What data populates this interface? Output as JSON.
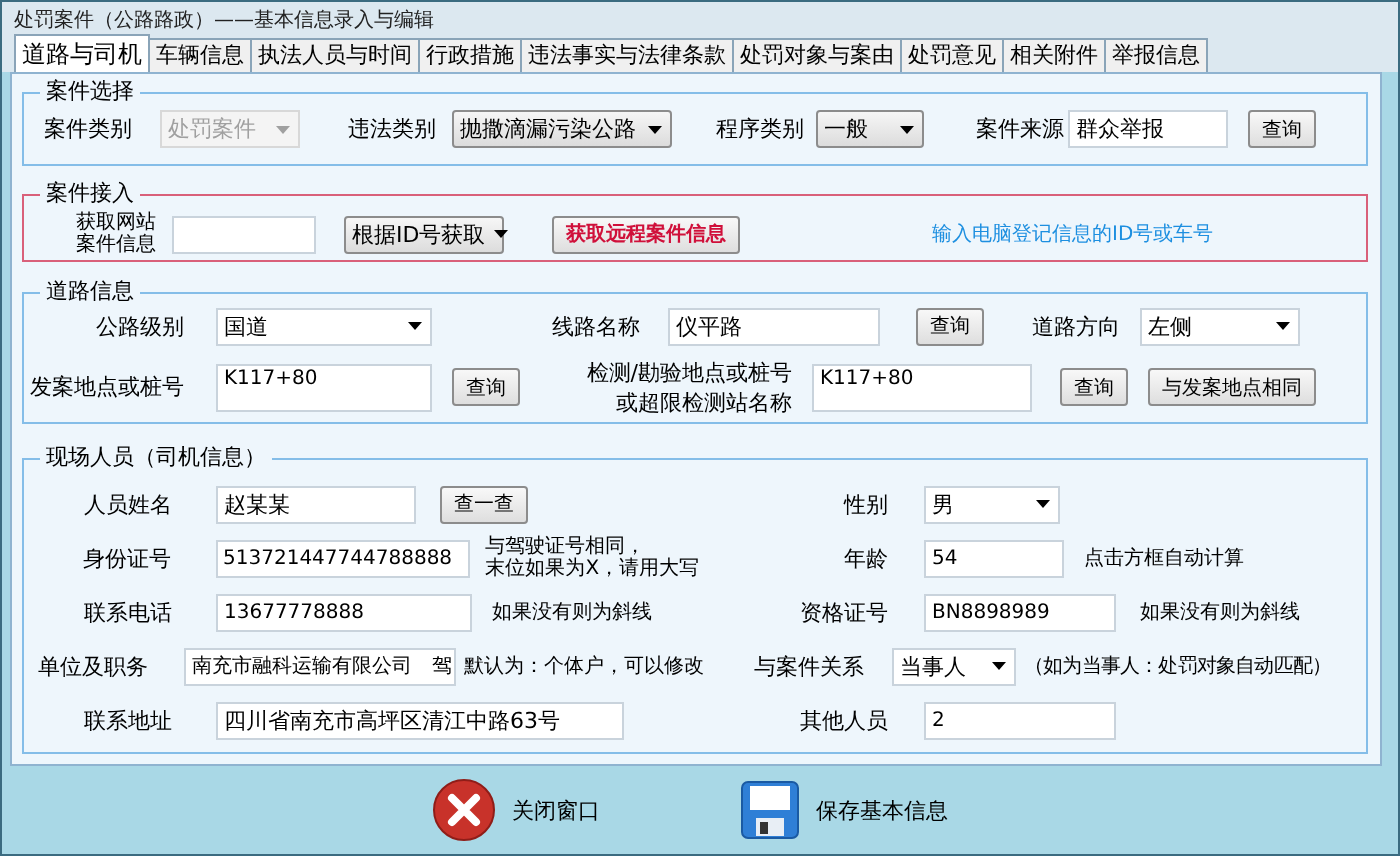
{
  "window": {
    "title": "处罚案件（公路路政）——基本信息录入与编辑"
  },
  "tabs": [
    {
      "label": "道路与司机",
      "selected": true
    },
    {
      "label": "车辆信息",
      "selected": false
    },
    {
      "label": "执法人员与时间",
      "selected": false
    },
    {
      "label": "行政措施",
      "selected": false
    },
    {
      "label": "违法事实与法律条款",
      "selected": false
    },
    {
      "label": "处罚对象与案由",
      "selected": false
    },
    {
      "label": "处罚意见",
      "selected": false
    },
    {
      "label": "相关附件",
      "selected": false
    },
    {
      "label": "举报信息",
      "selected": false
    }
  ],
  "case_selection": {
    "title": "案件选择",
    "case_type": {
      "label": "案件类别",
      "value": "处罚案件",
      "disabled": true
    },
    "violation_type": {
      "label": "违法类别",
      "value": "抛撒滴漏污染公路"
    },
    "procedure_type": {
      "label": "程序类别",
      "value": "一般"
    },
    "case_source": {
      "label": "案件来源",
      "value": "群众举报"
    },
    "query_button": "查询"
  },
  "case_import": {
    "title": "案件接入",
    "label_lines": [
      "获取网站",
      "案件信息"
    ],
    "method": "根据ID号获取",
    "fetch_button": "获取远程案件信息",
    "hint": "输入电脑登记信息的ID号或车号"
  },
  "road_info": {
    "title": "道路信息",
    "road_grade": {
      "label": "公路级别",
      "value": "国道"
    },
    "route_name": {
      "label": "线路名称",
      "value": "仪平路",
      "button": "查询"
    },
    "direction": {
      "label": "道路方向",
      "value": "左侧"
    },
    "incident_location": {
      "label": "发案地点或桩号",
      "value": "K117+80",
      "button": "查询"
    },
    "inspection_location": {
      "label_lines": [
        "检测/勘验地点或桩号",
        "或超限检测站名称"
      ],
      "value": "K117+80",
      "button": "查询",
      "same_button": "与发案地点相同"
    }
  },
  "personnel": {
    "title": "现场人员（司机信息）",
    "name": {
      "label": "人员姓名",
      "value": "赵某某",
      "button": "查一查"
    },
    "id_number": {
      "label": "身份证号",
      "value": "513721447744788888",
      "hint_lines": [
        "与驾驶证号相同，",
        "末位如果为X，请用大写"
      ]
    },
    "phone": {
      "label": "联系电话",
      "value": "13677778888",
      "hint": "如果没有则为斜线"
    },
    "employer": {
      "label": "单位及职务",
      "value": "南充市融科运输有限公司　驾",
      "hint": "默认为：个体户，可以修改"
    },
    "address": {
      "label": "联系地址",
      "value": "四川省南充市高坪区清江中路63号"
    },
    "gender": {
      "label": "性别",
      "value": "男"
    },
    "age": {
      "label": "年龄",
      "value": "54",
      "hint": "点击方框自动计算"
    },
    "qualification": {
      "label": "资格证号",
      "value": "BN8898989",
      "hint": "如果没有则为斜线"
    },
    "relation": {
      "label": "与案件关系",
      "value": "当事人",
      "hint": "（如为当事人：处罚对象自动匹配）"
    },
    "others": {
      "label": "其他人员",
      "value": "2"
    }
  },
  "buttons": [
    {
      "label": "关闭窗口",
      "kind": "close"
    },
    {
      "label": "保存基本信息",
      "kind": "save"
    }
  ]
}
